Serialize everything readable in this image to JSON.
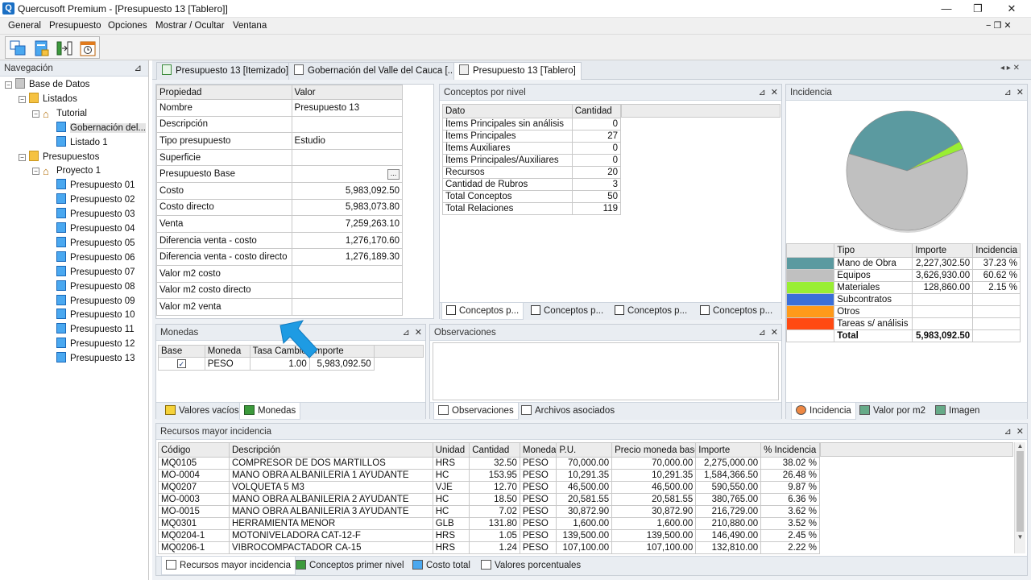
{
  "window": {
    "title": "Quercusoft Premium - [Presupuesto 13 [Tablero]]",
    "app_icon": "Q"
  },
  "menu": [
    "General",
    "Presupuesto",
    "Opciones",
    "Mostrar / Ocultar",
    "Ventana"
  ],
  "nav": {
    "title": "Navegación",
    "pin": "⊿",
    "tree": [
      {
        "label": "Base de Datos",
        "level": 0,
        "icon": "database-icon",
        "exp": "−"
      },
      {
        "label": "Listados",
        "level": 1,
        "icon": "folder-icon",
        "exp": "−"
      },
      {
        "label": "Tutorial",
        "level": 2,
        "icon": "home-icon",
        "exp": "−"
      },
      {
        "label": "Gobernación del...",
        "level": 3,
        "icon": "list-icon",
        "exp": ""
      },
      {
        "label": "Listado 1",
        "level": 3,
        "icon": "list-icon",
        "exp": ""
      },
      {
        "label": "Presupuestos",
        "level": 1,
        "icon": "folder-icon",
        "exp": "−"
      },
      {
        "label": "Proyecto 1",
        "level": 2,
        "icon": "home-icon",
        "exp": "−"
      },
      {
        "label": "Presupuesto 01",
        "level": 3,
        "icon": "budget-icon",
        "exp": ""
      },
      {
        "label": "Presupuesto 02",
        "level": 3,
        "icon": "budget-icon",
        "exp": ""
      },
      {
        "label": "Presupuesto 03",
        "level": 3,
        "icon": "budget-icon",
        "exp": ""
      },
      {
        "label": "Presupuesto 04",
        "level": 3,
        "icon": "budget-icon",
        "exp": ""
      },
      {
        "label": "Presupuesto 05",
        "level": 3,
        "icon": "budget-icon",
        "exp": ""
      },
      {
        "label": "Presupuesto 06",
        "level": 3,
        "icon": "budget-icon",
        "exp": ""
      },
      {
        "label": "Presupuesto 07",
        "level": 3,
        "icon": "budget-icon",
        "exp": ""
      },
      {
        "label": "Presupuesto 08",
        "level": 3,
        "icon": "budget-icon",
        "exp": ""
      },
      {
        "label": "Presupuesto 09",
        "level": 3,
        "icon": "budget-icon",
        "exp": ""
      },
      {
        "label": "Presupuesto 10",
        "level": 3,
        "icon": "budget-icon",
        "exp": ""
      },
      {
        "label": "Presupuesto 11",
        "level": 3,
        "icon": "budget-icon",
        "exp": ""
      },
      {
        "label": "Presupuesto 12",
        "level": 3,
        "icon": "budget-icon",
        "exp": ""
      },
      {
        "label": "Presupuesto 13",
        "level": 3,
        "icon": "budget-icon",
        "exp": ""
      }
    ]
  },
  "doctabs": [
    {
      "label": "Presupuesto 13 [Itemizado]",
      "active": false
    },
    {
      "label": "Gobernación del Valle del Cauca [...",
      "active": false
    },
    {
      "label": "Presupuesto 13 [Tablero]",
      "active": true
    }
  ],
  "props": {
    "headers": [
      "Propiedad",
      "Valor"
    ],
    "rows": [
      [
        "Nombre",
        "Presupuesto 13"
      ],
      [
        "Descripción",
        ""
      ],
      [
        "Tipo presupuesto",
        "Estudio"
      ],
      [
        "Superficie",
        ""
      ],
      [
        "Presupuesto Base",
        "..."
      ],
      [
        "Costo",
        "5,983,092.50"
      ],
      [
        "Costo directo",
        "5,983,073.80"
      ],
      [
        "Venta",
        "7,259,263.10"
      ],
      [
        "Diferencia venta - costo",
        "1,276,170.60"
      ],
      [
        "Diferencia venta - costo directo",
        "1,276,189.30"
      ],
      [
        "Valor m2 costo",
        ""
      ],
      [
        "Valor m2 costo directo",
        ""
      ],
      [
        "Valor m2 venta",
        ""
      ]
    ]
  },
  "conceptos": {
    "title": "Conceptos por nivel",
    "headers": [
      "Dato",
      "Cantidad"
    ],
    "rows": [
      [
        "Ítems Principales sin análisis",
        "0"
      ],
      [
        "Ítems Principales",
        "27"
      ],
      [
        "Ítems Auxiliares",
        "0"
      ],
      [
        "Ítems Principales/Auxiliares",
        "0"
      ],
      [
        "Recursos",
        "20"
      ],
      [
        "Cantidad de Rubros",
        "3"
      ],
      [
        "Total Conceptos",
        "50"
      ],
      [
        "Total Relaciones",
        "119"
      ]
    ],
    "tabs": [
      "Conceptos p...",
      "Conceptos p...",
      "Conceptos p...",
      "Conceptos p..."
    ]
  },
  "incidencia": {
    "title": "Incidencia",
    "headers": [
      "Tipo",
      "Importe",
      "Incidencia"
    ],
    "rows": [
      {
        "color": "#5b9aa0",
        "tipo": "Mano de Obra",
        "importe": "2,227,302.50",
        "inc": "37.23 %"
      },
      {
        "color": "#c0c0c0",
        "tipo": "Equipos",
        "importe": "3,626,930.00",
        "inc": "60.62 %"
      },
      {
        "color": "#99ee33",
        "tipo": "Materiales",
        "importe": "128,860.00",
        "inc": "2.15 %"
      },
      {
        "color": "#3a6fd8",
        "tipo": "Subcontratos",
        "importe": "",
        "inc": ""
      },
      {
        "color": "#ff9a1a",
        "tipo": "Otros",
        "importe": "",
        "inc": ""
      },
      {
        "color": "#ff4a12",
        "tipo": "Tareas s/ análisis",
        "importe": "",
        "inc": ""
      }
    ],
    "total": {
      "tipo": "Total",
      "importe": "5,983,092.50"
    },
    "tabs": [
      "Incidencia",
      "Valor por m2",
      "Imagen"
    ]
  },
  "monedas": {
    "title": "Monedas",
    "headers": [
      "Base",
      "Moneda",
      "Tasa Cambio",
      "Importe"
    ],
    "row": {
      "check": "✓",
      "moneda": "PESO",
      "tasa": "1.00",
      "importe": "5,983,092.50"
    },
    "tabs": [
      "Valores vacíos",
      "Monedas"
    ]
  },
  "observaciones": {
    "title": "Observaciones",
    "tabs": [
      "Observaciones",
      "Archivos asociados"
    ]
  },
  "recursos": {
    "title": "Recursos mayor incidencia",
    "headers": [
      "Código",
      "Descripción",
      "Unidad",
      "Cantidad",
      "Moneda",
      "P.U.",
      "Precio moneda base",
      "Importe",
      "% Incidencia"
    ],
    "rows": [
      [
        "MQ0105",
        "COMPRESOR DE DOS MARTILLOS",
        "HRS",
        "32.50",
        "PESO",
        "70,000.00",
        "70,000.00",
        "2,275,000.00",
        "38.02 %"
      ],
      [
        "MO-0004",
        "MANO OBRA ALBANILERIA 1 AYUDANTE",
        "HC",
        "153.95",
        "PESO",
        "10,291.35",
        "10,291.35",
        "1,584,366.50",
        "26.48 %"
      ],
      [
        "MQ0207",
        "VOLQUETA 5 M3",
        "VJE",
        "12.70",
        "PESO",
        "46,500.00",
        "46,500.00",
        "590,550.00",
        "9.87 %"
      ],
      [
        "MO-0003",
        "MANO OBRA ALBANILERIA 2 AYUDANTE",
        "HC",
        "18.50",
        "PESO",
        "20,581.55",
        "20,581.55",
        "380,765.00",
        "6.36 %"
      ],
      [
        "MO-0015",
        "MANO OBRA ALBANILERIA 3 AYUDANTE",
        "HC",
        "7.02",
        "PESO",
        "30,872.90",
        "30,872.90",
        "216,729.00",
        "3.62 %"
      ],
      [
        "MQ0301",
        "HERRAMIENTA MENOR",
        "GLB",
        "131.80",
        "PESO",
        "1,600.00",
        "1,600.00",
        "210,880.00",
        "3.52 %"
      ],
      [
        "MQ0204-1",
        "MOTONIVELADORA CAT-12-F",
        "HRS",
        "1.05",
        "PESO",
        "139,500.00",
        "139,500.00",
        "146,490.00",
        "2.45 %"
      ],
      [
        "MQ0206-1",
        "VIBROCOMPACTADOR CA-15",
        "HRS",
        "1.24",
        "PESO",
        "107,100.00",
        "107,100.00",
        "132,810.00",
        "2.22 %"
      ]
    ],
    "tabs": [
      "Recursos mayor incidencia",
      "Conceptos primer nivel",
      "Costo total",
      "Valores porcentuales"
    ]
  },
  "chart_data": {
    "type": "pie",
    "categories": [
      "Mano de Obra",
      "Equipos",
      "Materiales"
    ],
    "values": [
      37.23,
      60.62,
      2.15
    ],
    "colors": [
      "#5b9aa0",
      "#c0c0c0",
      "#99ee33"
    ]
  }
}
